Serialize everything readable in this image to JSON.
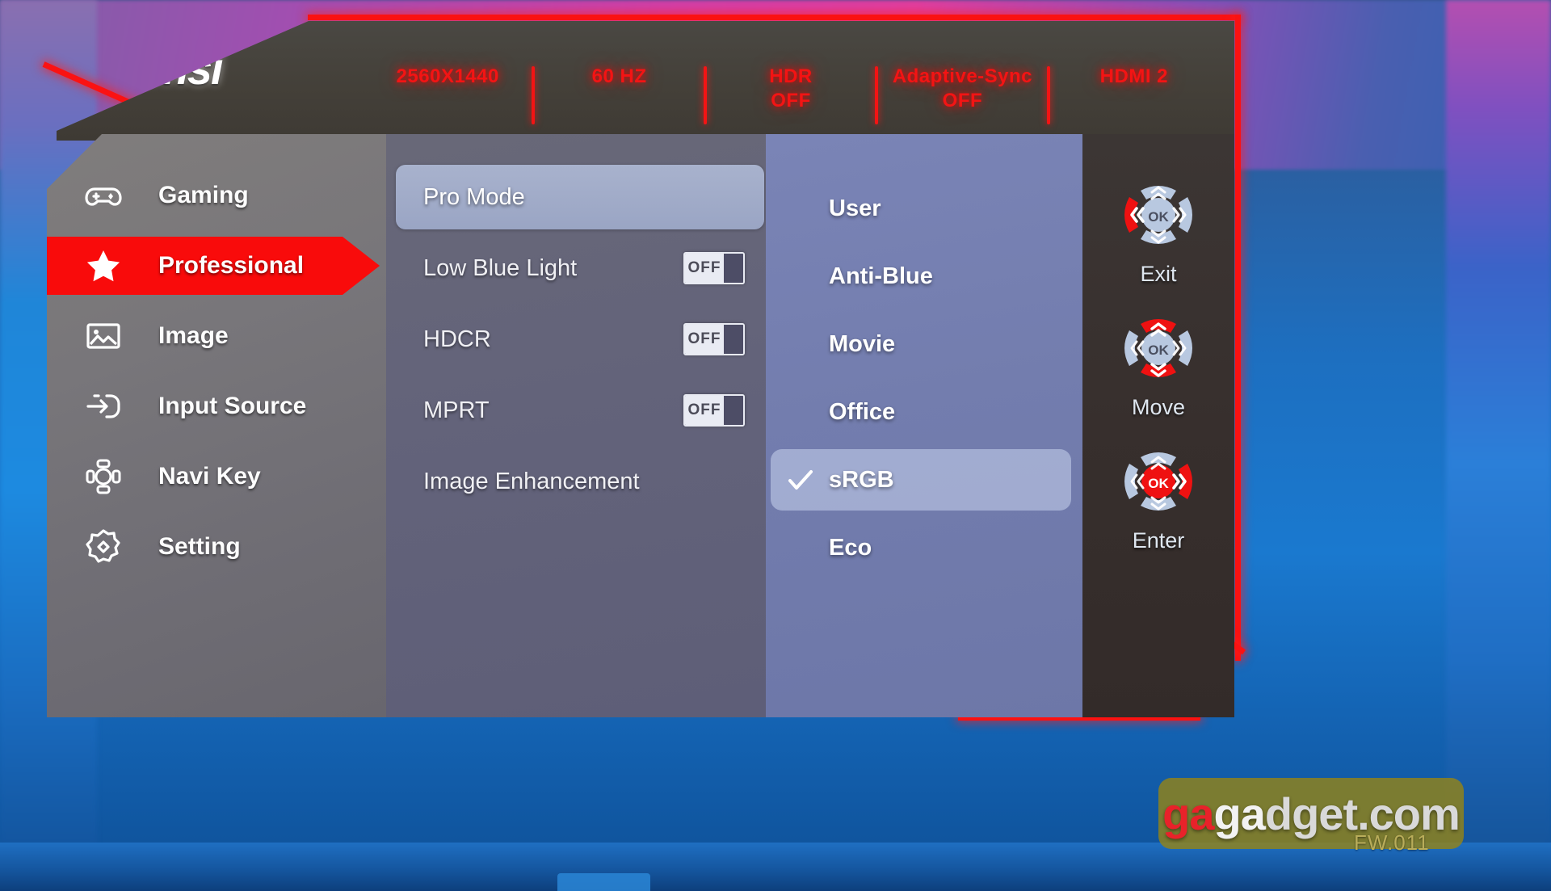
{
  "brand": {
    "name": "msi",
    "logo_icon": "msi-dragon-shield-icon"
  },
  "header": {
    "items": [
      {
        "text": "2560X1440"
      },
      {
        "text": "60 HZ"
      },
      {
        "text": "HDR\nOFF"
      },
      {
        "text": "Adaptive-Sync\nOFF"
      },
      {
        "text": "HDMI 2"
      }
    ],
    "accent_color": "#f31414"
  },
  "sidebar": {
    "items": [
      {
        "label": "Gaming",
        "icon": "gamepad-icon",
        "active": false
      },
      {
        "label": "Professional",
        "icon": "star-icon",
        "active": true
      },
      {
        "label": "Image",
        "icon": "picture-icon",
        "active": false
      },
      {
        "label": "Input Source",
        "icon": "input-arrow-icon",
        "active": false
      },
      {
        "label": "Navi Key",
        "icon": "navi-key-icon",
        "active": false
      },
      {
        "label": "Setting",
        "icon": "gear-icon",
        "active": false
      }
    ],
    "active_color": "#f90b0b"
  },
  "middle": {
    "items": [
      {
        "label": "Pro Mode",
        "selected": true,
        "toggle": null
      },
      {
        "label": "Low Blue Light",
        "selected": false,
        "toggle": "OFF"
      },
      {
        "label": "HDCR",
        "selected": false,
        "toggle": "OFF"
      },
      {
        "label": "MPRT",
        "selected": false,
        "toggle": "OFF"
      },
      {
        "label": "Image Enhancement",
        "selected": false,
        "toggle": null
      }
    ]
  },
  "options": {
    "items": [
      {
        "label": "User",
        "selected": false
      },
      {
        "label": "Anti-Blue",
        "selected": false
      },
      {
        "label": "Movie",
        "selected": false
      },
      {
        "label": "Office",
        "selected": false
      },
      {
        "label": "sRGB",
        "selected": true
      },
      {
        "label": "Eco",
        "selected": false
      }
    ],
    "check_icon": "check-icon"
  },
  "navkeys": [
    {
      "label": "Exit",
      "icon": "navkey-left-icon",
      "ok_text": "OK",
      "active": {
        "up": false,
        "down": false,
        "left": true,
        "right": false,
        "ok": false
      }
    },
    {
      "label": "Move",
      "icon": "navkey-updown-icon",
      "ok_text": "OK",
      "active": {
        "up": true,
        "down": true,
        "left": false,
        "right": false,
        "ok": false
      }
    },
    {
      "label": "Enter",
      "icon": "navkey-ok-icon",
      "ok_text": "OK",
      "active": {
        "up": false,
        "down": false,
        "left": false,
        "right": true,
        "ok": true
      }
    }
  ],
  "watermark": {
    "part_red": "ga",
    "part_white": "ga",
    "part_rest": "dget.com",
    "firmware": "FW.011"
  }
}
